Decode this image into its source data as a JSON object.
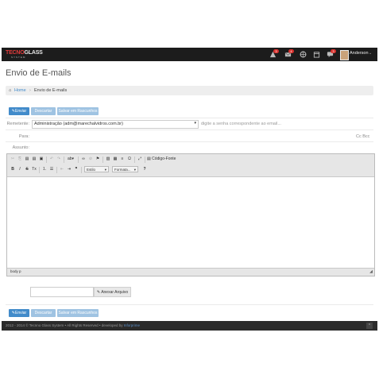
{
  "app": {
    "logo_main": "TECNO",
    "logo_accent": "GLASS",
    "logo_sub": "SYSTEM",
    "user_name": "Anderson",
    "badges": [
      "3",
      "4",
      "3"
    ]
  },
  "page": {
    "title": "Envio de E-mails",
    "breadcrumb": {
      "home": "Home",
      "separator": "›",
      "current": "Envio de E-mails"
    }
  },
  "actions": {
    "send": "Enviar",
    "discard": "Descartar",
    "save_draft": "Salvar em Rascunhos"
  },
  "form": {
    "sender_label": "Remetente:",
    "sender_value": "Administração (adm@marechalvidros.com.br)",
    "password_placeholder": "digite a senha correspondente ao email...",
    "to_label": "Para:",
    "cc_bcc": "Cc  Bcc",
    "subject_label": "Assunto:"
  },
  "editor": {
    "source_label": "Código-Fonte",
    "style_label": "Estilo",
    "format_label": "Formata...",
    "help": "?",
    "status_path": "body  p"
  },
  "attach": {
    "button": "Anexar Arquivo"
  },
  "footer": {
    "text": "2012 - 2014 © Tecnno Glass System  •  All Rights Reserved  •  developed by ",
    "link": "Inforprime"
  },
  "colors": {
    "primary": "#428bca",
    "topbar": "#1c1c1c",
    "badge": "#d9302c",
    "logo_red": "#e23b3b"
  }
}
